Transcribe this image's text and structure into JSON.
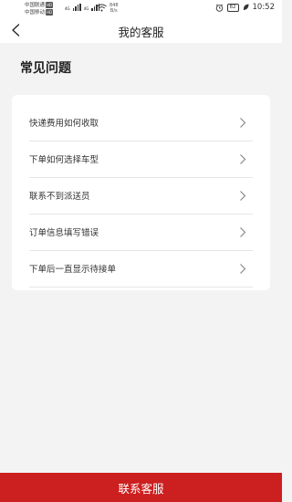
{
  "status_bar": {
    "carrier_1": "中国联通",
    "carrier_2": "中国移动",
    "hd_badge": "HD",
    "signal_label_1": "4G",
    "signal_label_2": "4G",
    "net_speed_value": "848",
    "net_speed_unit": "B/s",
    "battery": "82",
    "time": "10:52"
  },
  "nav": {
    "title": "我的客服"
  },
  "faq": {
    "section_title": "常见问题",
    "items": [
      {
        "label": "快递费用如何收取"
      },
      {
        "label": "下单如何选择车型"
      },
      {
        "label": "联系不到派送员"
      },
      {
        "label": "订单信息填写错误"
      },
      {
        "label": "下单后一直显示待接单"
      }
    ]
  },
  "footer": {
    "contact_label": "联系客服"
  },
  "colors": {
    "accent": "#cc1f1f",
    "background": "#f3f3f3",
    "card": "#ffffff"
  }
}
